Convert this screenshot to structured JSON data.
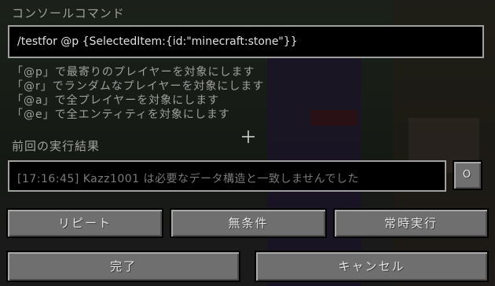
{
  "labels": {
    "console_command": "コンソールコマンド",
    "previous_output": "前回の実行結果"
  },
  "command_input": {
    "value": "/testfor @p {SelectedItem:{id:\"minecraft:stone\"}}"
  },
  "hints": [
    "「@p」で最寄りのプレイヤーを対象にします",
    "「@r」でランダムなプレイヤーを対象にします",
    "「@a」で全プレイヤーを対象にします",
    "「@e」で全エンティティを対象にします"
  ],
  "output": {
    "text": "[17:16:45] Kazz1001 は必要なデータ構造と一致しませんでした"
  },
  "buttons": {
    "output_toggle": "O",
    "repeat": "リピート",
    "unconditional": "無条件",
    "always_active": "常時実行",
    "done": "完了",
    "cancel": "キャンセル"
  }
}
